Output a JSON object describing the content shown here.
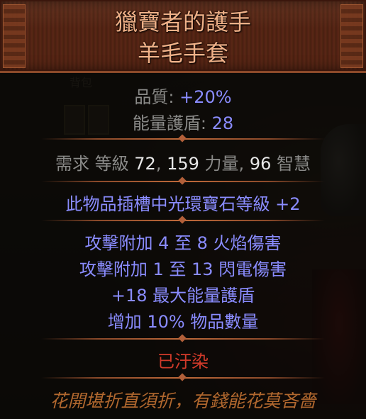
{
  "background": {
    "tab_label": "背包"
  },
  "item": {
    "name": "獵寶者的護手",
    "base_type": "羊毛手套",
    "properties": [
      {
        "label": "品質: ",
        "value": "+20%"
      },
      {
        "label": "能量護盾: ",
        "value": "28"
      }
    ],
    "requirements": {
      "prefix": "需求 ",
      "level_label": "等級 ",
      "level": "72",
      "sep1": ", ",
      "str": "159",
      "str_label": " 力量",
      "sep2": ", ",
      "int": "96",
      "int_label": " 智慧"
    },
    "implicit": "此物品插槽中光環寶石等級 +2",
    "explicit_mods": [
      "攻擊附加 4 至 8 火焰傷害",
      "攻擊附加 1 至 13 閃電傷害",
      "+18 最大能量護盾",
      "增加 10% 物品數量"
    ],
    "corrupted": "已汙染",
    "flavour_text": "花開堪折直須折，有錢能花莫吝嗇"
  },
  "colors": {
    "name": "#f0b188",
    "magic": "#8a8cff",
    "corrupted": "#d23a2a",
    "flavour": "#b0672e"
  }
}
